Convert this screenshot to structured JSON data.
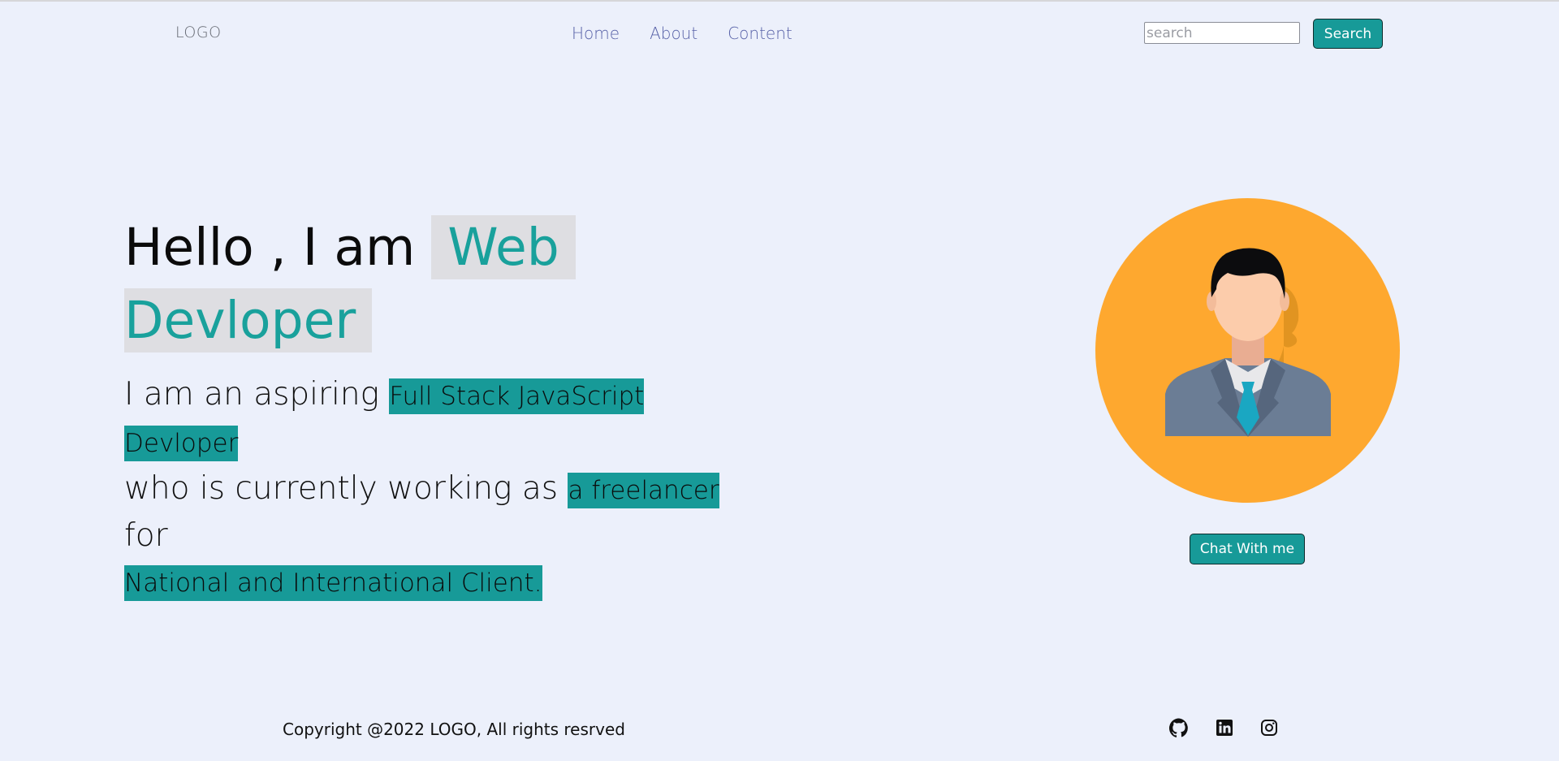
{
  "header": {
    "logo": "LOGO",
    "nav": [
      "Home",
      "About",
      "Content"
    ],
    "search_placeholder": "search",
    "search_button": "Search"
  },
  "hero": {
    "title_prefix": "Hello , I am ",
    "title_highlight_1": "Web",
    "title_highlight_2": "Devloper",
    "sub_part_1": "I am an aspiring ",
    "sub_hl_1": "Full Stack JavaScript",
    "sub_hl_2": "Devloper",
    "sub_part_2": "who is currently working as ",
    "sub_hl_3": "a freelancer",
    "sub_part_3": " for",
    "sub_hl_4": "National and International Client."
  },
  "profile": {
    "avatar_icon": "businessman-avatar",
    "chat_button": "Chat With me",
    "colors": {
      "circle": "#fea82f",
      "suit": "#6b7d95",
      "tie": "#1aa7c2"
    }
  },
  "footer": {
    "copyright": "Copyright @2022 LOGO, All rights resrved",
    "social": [
      "github-icon",
      "linkedin-icon",
      "instagram-icon"
    ]
  },
  "colors": {
    "background": "#ecf0fb",
    "accent": "#179a98",
    "nav_link": "#5862a8"
  }
}
